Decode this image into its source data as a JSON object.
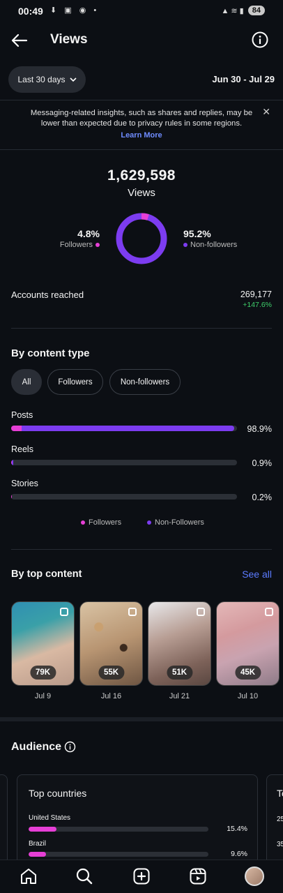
{
  "status_bar": {
    "time": "00:49",
    "battery": "84"
  },
  "header": {
    "title": "Views"
  },
  "filter": {
    "range_label": "Last 30 days",
    "date_range": "Jun 30 - Jul 29"
  },
  "notice": {
    "text": "Messaging-related insights, such as shares and replies, may be lower than expected due to privacy rules in some regions.",
    "link": "Learn More"
  },
  "summary": {
    "total": "1,629,598",
    "label": "Views",
    "followers_pct": "4.8%",
    "followers_label": "Followers",
    "followers_fraction": 0.048,
    "non_followers_pct": "95.2%",
    "non_followers_label": "Non-followers",
    "accounts_reached_label": "Accounts reached",
    "accounts_reached_value": "269,177",
    "accounts_reached_change": "+147.6%"
  },
  "colors": {
    "followers": "#e63fd6",
    "non_followers": "#7c3cf0"
  },
  "content_type": {
    "title": "By content type",
    "chips": [
      "All",
      "Followers",
      "Non-followers"
    ],
    "rows": [
      {
        "label": "Posts",
        "pct": "98.9%",
        "fraction": 0.989,
        "followers_share": 0.048
      },
      {
        "label": "Reels",
        "pct": "0.9%",
        "fraction": 0.009,
        "followers_share": 0.2
      },
      {
        "label": "Stories",
        "pct": "0.2%",
        "fraction": 0.002,
        "followers_share": 0.5
      }
    ],
    "legend": {
      "followers": "Followers",
      "non_followers": "Non-Followers"
    }
  },
  "top_content": {
    "title": "By top content",
    "see_all": "See all",
    "items": [
      {
        "count": "79K",
        "date": "Jul 9"
      },
      {
        "count": "55K",
        "date": "Jul 16"
      },
      {
        "count": "51K",
        "date": "Jul 21"
      },
      {
        "count": "45K",
        "date": "Jul 10"
      }
    ]
  },
  "audience": {
    "title": "Audience",
    "top_countries": {
      "title": "Top countries",
      "rows": [
        {
          "country": "United States",
          "pct": "15.4%",
          "fraction": 0.154
        },
        {
          "country": "Brazil",
          "pct": "9.6%",
          "fraction": 0.096
        }
      ]
    },
    "next_card_partial": {
      "title": "To",
      "values": [
        "25",
        "35"
      ]
    }
  },
  "nav": [
    "home-icon",
    "search-icon",
    "create-icon",
    "reels-icon",
    "profile-avatar"
  ]
}
